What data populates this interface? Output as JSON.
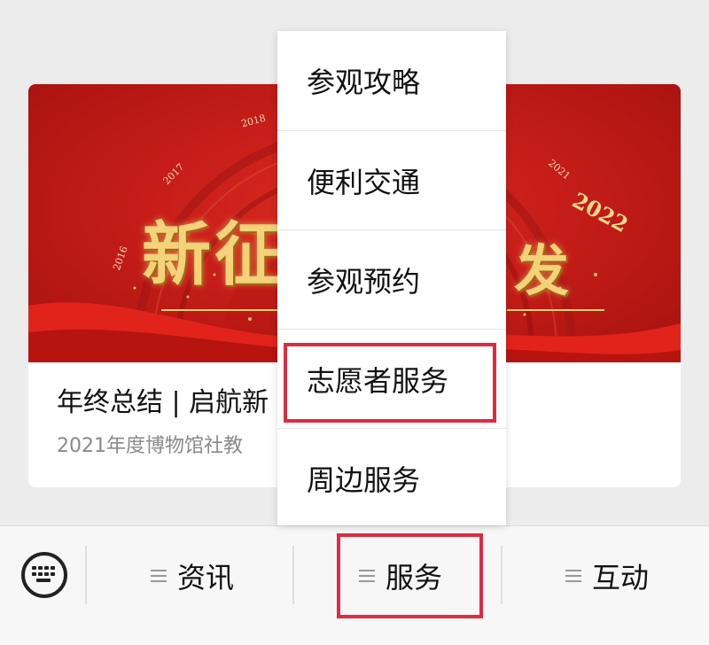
{
  "article": {
    "title": "年终总结 | 启航新",
    "subtitle": "2021年度博物馆社教",
    "banner": {
      "years": [
        "2016",
        "2017",
        "2018",
        "2021"
      ],
      "year_highlight": "2022",
      "headline_left": "新征",
      "headline_right": "发"
    }
  },
  "popup_menu": {
    "items": [
      {
        "label": "参观攻略"
      },
      {
        "label": "便利交通"
      },
      {
        "label": "参观预约"
      },
      {
        "label": "志愿者服务"
      },
      {
        "label": "周边服务"
      }
    ]
  },
  "menubar": {
    "tabs": [
      {
        "label": "资讯"
      },
      {
        "label": "服务"
      },
      {
        "label": "互动"
      }
    ]
  },
  "colors": {
    "highlight": "#e02a3f",
    "banner_red": "#c61d18",
    "gold": "#f3d27a"
  }
}
